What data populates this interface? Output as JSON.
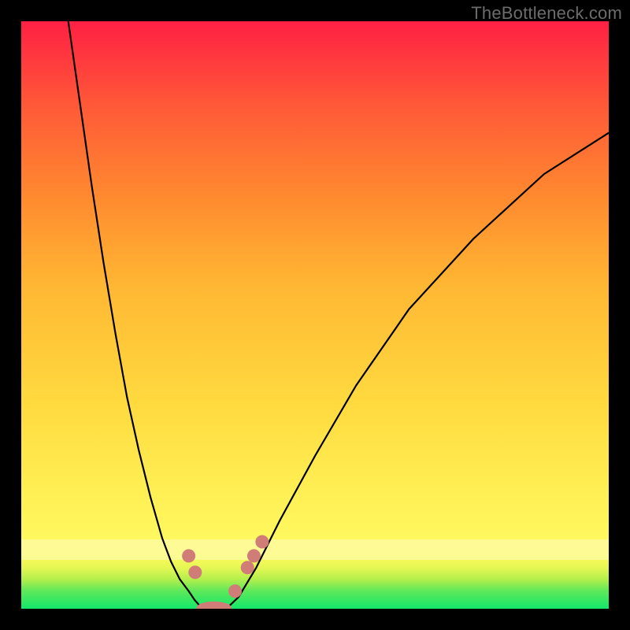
{
  "watermark": "TheBottleneck.com",
  "colors": {
    "frame": "#000000",
    "marker": "#d07d78",
    "curve": "#000000"
  },
  "chart_data": {
    "type": "line",
    "title": "",
    "xlabel": "",
    "ylabel": "",
    "xlim": [
      0,
      100
    ],
    "ylim": [
      0,
      100
    ],
    "note": "No numeric axes or labels are rendered in the image; values below are estimated pixel-proportional positions (0–100) of the visible curve and marker dots.",
    "series": [
      {
        "name": "left-branch",
        "x": [
          8,
          10,
          12,
          14,
          16,
          18,
          20,
          22,
          24,
          25.5,
          27,
          28.5,
          29.5,
          30.3,
          31
        ],
        "y": [
          100,
          86,
          72,
          59,
          47,
          36,
          27,
          19,
          12,
          8,
          5,
          3,
          1.5,
          0.6,
          0.1
        ]
      },
      {
        "name": "bottom-flat",
        "x": [
          31,
          33,
          35
        ],
        "y": [
          0.1,
          0.1,
          0.1
        ]
      },
      {
        "name": "right-branch",
        "x": [
          35,
          37,
          40,
          44,
          50,
          57,
          66,
          77,
          89,
          100
        ],
        "y": [
          0.1,
          2,
          7,
          15,
          26,
          38,
          51,
          63,
          74,
          81
        ]
      }
    ],
    "markers": [
      {
        "name": "left-upper-dot",
        "x": 28.5,
        "y": 9.0
      },
      {
        "name": "left-lower-dot",
        "x": 29.6,
        "y": 6.2
      },
      {
        "name": "bottom-oval",
        "x": 32.8,
        "y": 0.1,
        "shape": "oval"
      },
      {
        "name": "right-low-dot",
        "x": 36.4,
        "y": 3.0
      },
      {
        "name": "right-mid1-dot",
        "x": 38.5,
        "y": 7.0
      },
      {
        "name": "right-mid2-dot",
        "x": 39.6,
        "y": 9.0
      },
      {
        "name": "right-high-dot",
        "x": 41.0,
        "y": 11.4
      }
    ]
  }
}
